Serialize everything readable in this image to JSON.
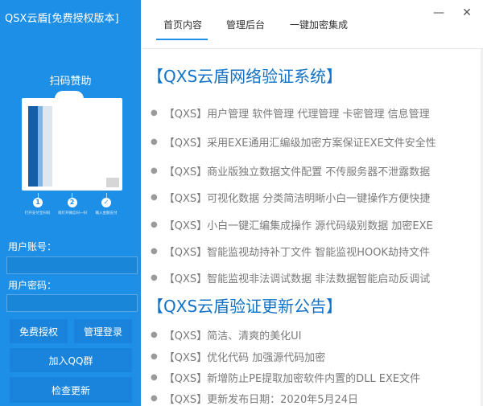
{
  "app": {
    "title": "QSX云盾[免费授权版本]"
  },
  "left": {
    "scan_label": "扫码赞助",
    "pay_steps": [
      {
        "icon": "1",
        "caption": "打开支付宝扫码"
      },
      {
        "icon": "2",
        "caption": "或打开微信扫一扫"
      },
      {
        "icon": "✓",
        "caption": "输入金额支付"
      }
    ],
    "account_label": "用户账号：",
    "account_value": "",
    "password_label": "用户密码：",
    "password_value": "",
    "buttons": {
      "free_auth": "免费授权",
      "admin_login": "管理登录",
      "join_qq": "加入QQ群",
      "check_update": "检查更新"
    }
  },
  "tabs": [
    "首页内容",
    "管理后台",
    "一键加密集成"
  ],
  "window": {
    "minimize": "—",
    "close": "✕"
  },
  "sections": {
    "system_title": "【QXS云盾网络验证系统】",
    "system_items": [
      "【QXS】用户管理 软件管理 代理管理 卡密管理 信息管理",
      "【QXS】采用EXE通用汇编级加密方案保证EXE文件安全性",
      "【QXS】商业版独立数据文件配置 不传服务器不泄露数据",
      "【QXS】可视化数据 分类简洁明晰小白一键操作方便快捷",
      "【QXS】小白一键汇编集成操作 源代码级别数据 加密EXE",
      "【QXS】智能监视劫持补丁文件 智能监视HOOK劫持文件",
      "【QXS】智能监视非法调试数据 非法数据智能启动反调试"
    ],
    "update_title": "【QXS云盾验证更新公告】",
    "update_items": [
      "【QXS】简洁、清爽的美化UI",
      "【QXS】优化代码 加强源代码加密",
      "【QXS】新增防止PE提取加密软件内置的DLL EXE文件",
      "【QXS】更新发布日期：2020年5月24日"
    ]
  },
  "colors": {
    "primary": "#1e8fe6",
    "title_blue": "#1473c7",
    "item_gray": "#7a7a7a"
  }
}
